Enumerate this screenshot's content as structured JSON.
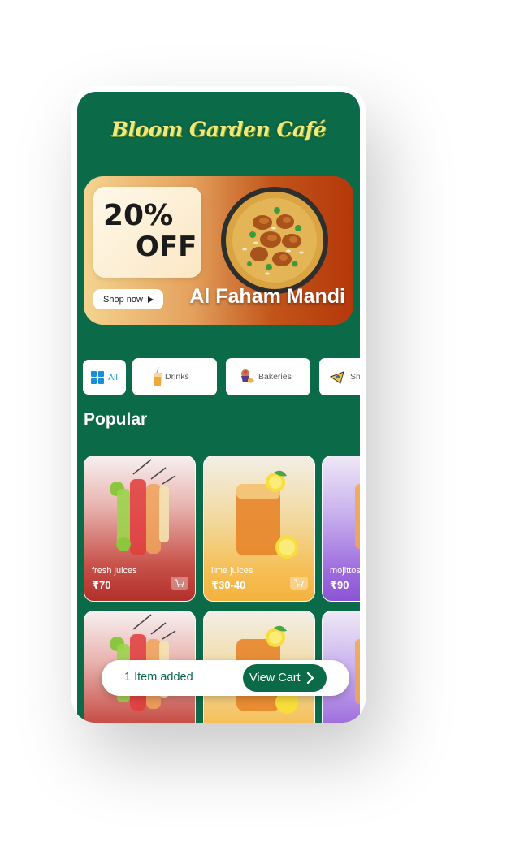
{
  "app": {
    "logo_text": "Bloom Garden Café"
  },
  "banner": {
    "discount": "20%",
    "discount_suffix": "OFF",
    "cta": "Shop now",
    "dish_name": "Al Faham Mandi",
    "icon": "play-icon"
  },
  "categories": [
    {
      "label": "All",
      "icon": "grid-icon",
      "selected": true
    },
    {
      "label": "Drinks",
      "icon": "drink-icon"
    },
    {
      "label": "Bakeries",
      "icon": "cupcake-icon"
    },
    {
      "label": "Sn",
      "icon": "snack-icon"
    }
  ],
  "section": {
    "title": "Popular"
  },
  "products": [
    {
      "name": "fresh juices",
      "price": "₹70",
      "icon": "cart-icon"
    },
    {
      "name": "lime juices",
      "price": "₹30-40",
      "icon": "cart-icon"
    },
    {
      "name": "mojittos",
      "price": "₹90",
      "icon": "cart-icon"
    }
  ],
  "cart_bar": {
    "status": "1 Item added",
    "button_label": "View Cart",
    "icon": "chevron-right-icon"
  },
  "colors": {
    "brand_green": "#0b6a47",
    "logo_yellow": "#f1e87c",
    "category_accent": "#1a8fd6",
    "card_red": "#b2302b",
    "card_orange": "#f4b23e",
    "card_purple": "#8b55d3"
  }
}
